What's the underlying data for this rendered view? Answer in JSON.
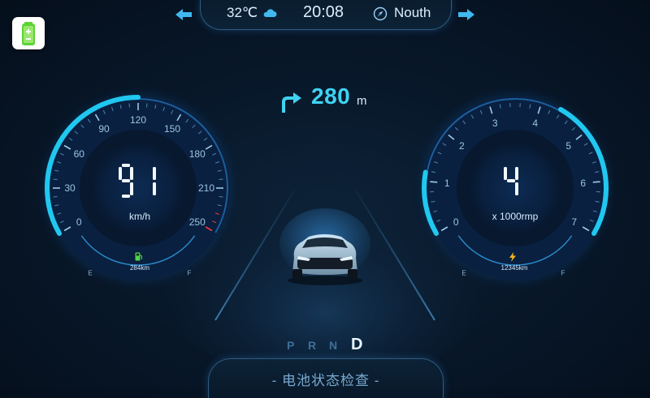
{
  "status_bar": {
    "temperature": "32℃",
    "weather_icon": "cloud-icon",
    "time": "20:08",
    "direction_icon": "compass-icon",
    "direction": "Nouth"
  },
  "navigation": {
    "distance": "280",
    "unit": "m",
    "turn_icon": "turn-right-icon"
  },
  "speedometer": {
    "value_digits": "91",
    "unit": "km/h",
    "ticks": [
      "0",
      "30",
      "60",
      "90",
      "120",
      "150",
      "180",
      "210",
      "250"
    ],
    "range_label": "284km",
    "range_icon": "fuel-icon",
    "gauge_empty": "E",
    "gauge_full": "F"
  },
  "tachometer": {
    "value_digits": "4",
    "unit": "x 1000rmp",
    "ticks": [
      "0",
      "1",
      "2",
      "3",
      "4",
      "5",
      "6",
      "7"
    ],
    "odometer": "12345km",
    "odometer_icon": "lightning-icon",
    "gauge_empty": "E",
    "gauge_full": "F"
  },
  "gears": [
    "P",
    "R",
    "N",
    "D"
  ],
  "active_gear": "D",
  "bottom_button": {
    "label": "- 电池状态检查 -"
  },
  "colors": {
    "accent": "#27d6f5",
    "background": "#07162a",
    "gauge_red": "#ff3a3a"
  }
}
